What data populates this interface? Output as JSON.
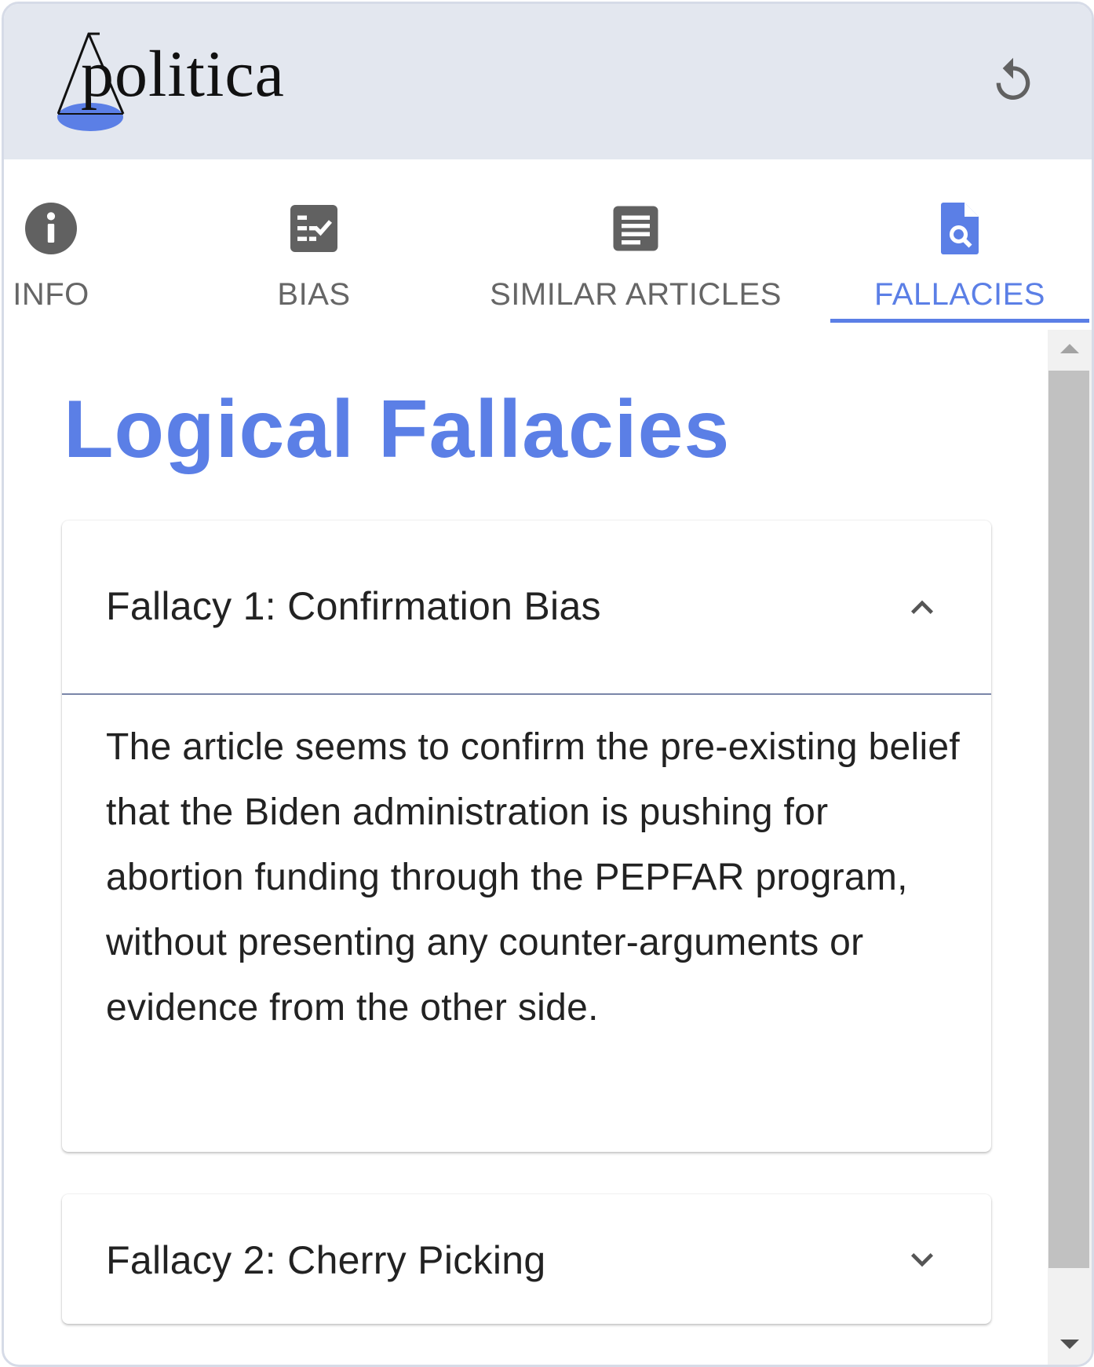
{
  "app": {
    "brand": "politica",
    "accent_color": "#5b7fe6",
    "reload_icon": "reload-icon"
  },
  "tabs": [
    {
      "label": "INFO",
      "icon": "info-icon",
      "active": false
    },
    {
      "label": "BIAS",
      "icon": "checklist-icon",
      "active": false
    },
    {
      "label": "SIMILAR ARTICLES",
      "icon": "article-icon",
      "active": false
    },
    {
      "label": "FALLACIES",
      "icon": "document-search-icon",
      "active": true
    }
  ],
  "main": {
    "title": "Logical Fallacies",
    "fallacies": [
      {
        "title": "Fallacy 1: Confirmation Bias",
        "expanded": true,
        "description": "The article seems to confirm the pre-existing belief that the Biden administration is pushing for abortion funding through the PEPFAR program, without presenting any counter-arguments or evidence from the other side."
      },
      {
        "title": "Fallacy 2: Cherry Picking",
        "expanded": false,
        "description": ""
      }
    ]
  }
}
